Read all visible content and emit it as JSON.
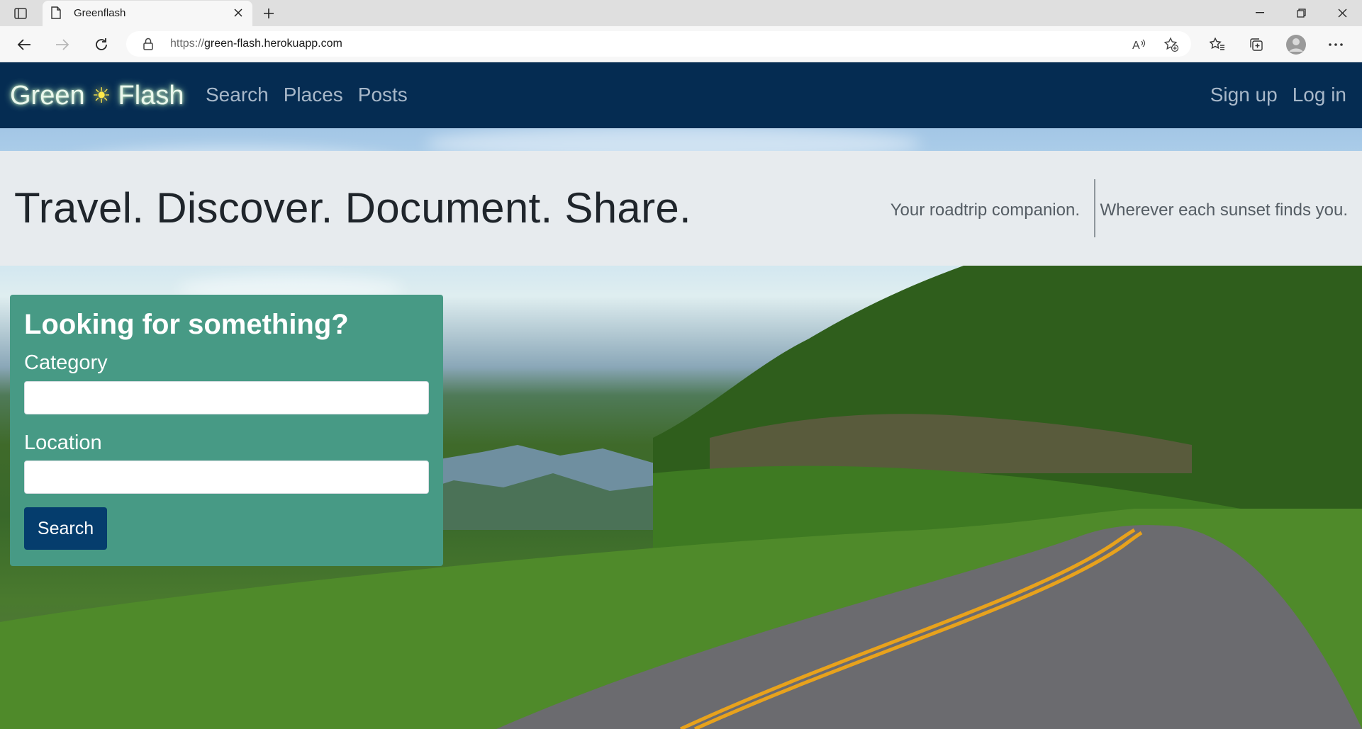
{
  "browser": {
    "tab_title": "Greenflash",
    "url_host": "green-flash.herokuapp.com",
    "url_scheme": "https://"
  },
  "site": {
    "brand_left": "Green",
    "brand_icon": "sun-icon",
    "brand_right": "Flash",
    "nav": [
      "Search",
      "Places",
      "Posts"
    ],
    "nav_right": [
      "Sign up",
      "Log in"
    ]
  },
  "banner": {
    "headline": "Travel. Discover. Document. Share.",
    "tagline_1": "Your roadtrip companion.",
    "tagline_2": "Wherever each sunset finds you."
  },
  "search_card": {
    "title": "Looking for something?",
    "category_label": "Category",
    "category_value": "",
    "location_label": "Location",
    "location_value": "",
    "button_label": "Search"
  },
  "colors": {
    "navbar": "#052c52",
    "card": "#479a85",
    "button": "#053d6d",
    "banner": "#e7ebee"
  }
}
